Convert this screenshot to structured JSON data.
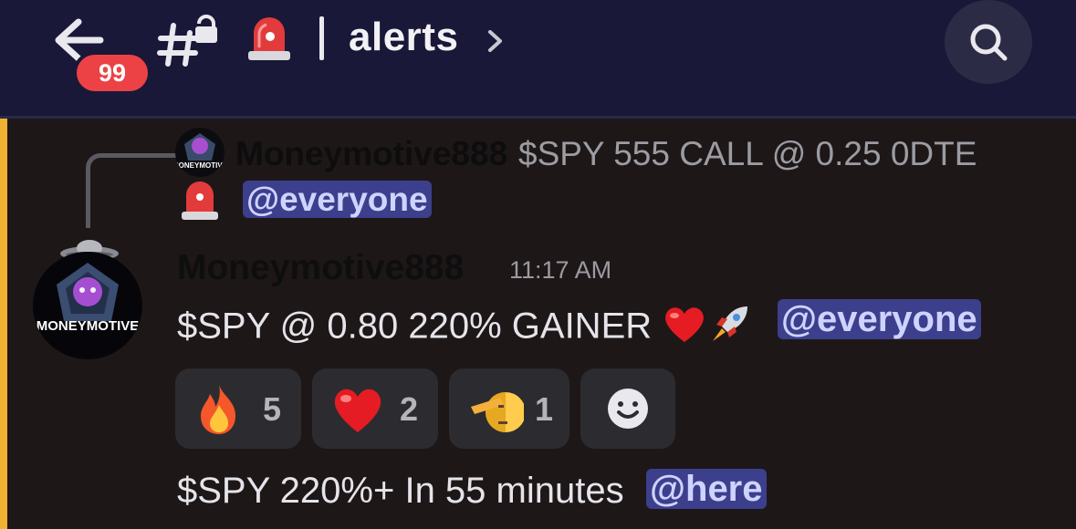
{
  "header": {
    "unread_badge": "99",
    "channel_name": "alerts"
  },
  "reply_preview": {
    "author": "Moneymotive888",
    "text": "$SPY 555 CALL @ 0.25 0DTE",
    "mention": "@everyone",
    "avatar_text": "MONEYMOTIVE"
  },
  "message": {
    "author": "Moneymotive888",
    "timestamp": "11:17 AM",
    "text": "$SPY @ 0.80 220% GAINER",
    "mention": "@everyone",
    "avatar_text": "MONEYMOTIVE"
  },
  "reactions": [
    {
      "emoji": "fire",
      "count": "5"
    },
    {
      "emoji": "red-heart",
      "count": "2"
    },
    {
      "emoji": "saluting-face",
      "count": "1"
    }
  ],
  "followup": {
    "text": "$SPY 220%+ In 55 minutes",
    "mention": "@here"
  },
  "colors": {
    "header_bg": "#191838",
    "highlight_bar": "#f0b232",
    "mention_bg": "#3c3f8c",
    "badge_red": "#ec4245"
  }
}
